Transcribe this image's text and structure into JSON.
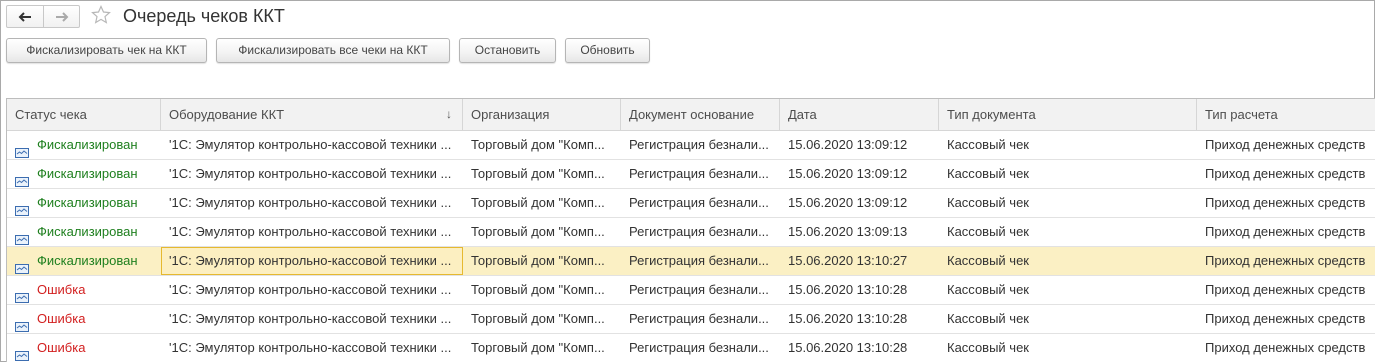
{
  "window": {
    "title": "Очередь чеков ККТ"
  },
  "toolbar": {
    "buttons": [
      "Фискализировать чек на ККТ",
      "Фискализировать все чеки на ККТ",
      "Остановить",
      "Обновить"
    ]
  },
  "table": {
    "sort_indicator": "↓",
    "columns": [
      "Статус чека",
      "Оборудование ККТ",
      "Организация",
      "Документ основание",
      "Дата",
      "Тип документа",
      "Тип расчета"
    ],
    "rows": [
      {
        "status": "Фискализирован",
        "status_kind": "ok",
        "equipment": "'1С: Эмулятор контрольно-кассовой техники ...",
        "organization": "Торговый дом \"Комп...",
        "document": "Регистрация безнали...",
        "date": "15.06.2020 13:09:12",
        "doc_type": "Кассовый чек",
        "payment_type": "Приход денежных средств"
      },
      {
        "status": "Фискализирован",
        "status_kind": "ok",
        "equipment": "'1С: Эмулятор контрольно-кассовой техники ...",
        "organization": "Торговый дом \"Комп...",
        "document": "Регистрация безнали...",
        "date": "15.06.2020 13:09:12",
        "doc_type": "Кассовый чек",
        "payment_type": "Приход денежных средств"
      },
      {
        "status": "Фискализирован",
        "status_kind": "ok",
        "equipment": "'1С: Эмулятор контрольно-кассовой техники ...",
        "organization": "Торговый дом \"Комп...",
        "document": "Регистрация безнали...",
        "date": "15.06.2020 13:09:12",
        "doc_type": "Кассовый чек",
        "payment_type": "Приход денежных средств"
      },
      {
        "status": "Фискализирован",
        "status_kind": "ok",
        "equipment": "'1С: Эмулятор контрольно-кассовой техники ...",
        "organization": "Торговый дом \"Комп...",
        "document": "Регистрация безнали...",
        "date": "15.06.2020 13:09:13",
        "doc_type": "Кассовый чек",
        "payment_type": "Приход денежных средств"
      },
      {
        "status": "Фискализирован",
        "status_kind": "ok",
        "selected": true,
        "equipment": "'1С: Эмулятор контрольно-кассовой техники ...",
        "organization": "Торговый дом \"Комп...",
        "document": "Регистрация безнали...",
        "date": "15.06.2020 13:10:27",
        "doc_type": "Кассовый чек",
        "payment_type": "Приход денежных средств"
      },
      {
        "status": "Ошибка",
        "status_kind": "error",
        "equipment": "'1С: Эмулятор контрольно-кассовой техники ...",
        "organization": "Торговый дом \"Комп...",
        "document": "Регистрация безнали...",
        "date": "15.06.2020 13:10:28",
        "doc_type": "Кассовый чек",
        "payment_type": "Приход денежных средств"
      },
      {
        "status": "Ошибка",
        "status_kind": "error",
        "equipment": "'1С: Эмулятор контрольно-кассовой техники ...",
        "organization": "Торговый дом \"Комп...",
        "document": "Регистрация безнали...",
        "date": "15.06.2020 13:10:28",
        "doc_type": "Кассовый чек",
        "payment_type": "Приход денежных средств"
      },
      {
        "status": "Ошибка",
        "status_kind": "error",
        "equipment": "'1С: Эмулятор контрольно-кассовой техники ...",
        "organization": "Торговый дом \"Комп...",
        "document": "Регистрация безнали...",
        "date": "15.06.2020 13:10:28",
        "doc_type": "Кассовый чек",
        "payment_type": "Приход денежных средств"
      }
    ]
  },
  "colors": {
    "ok": "#1e7f1e",
    "error": "#d21f1f",
    "selected_row": "#fbf0c4",
    "focus_border": "#e6b92f"
  },
  "icons": {
    "back": "arrow-left-icon",
    "forward": "arrow-right-icon",
    "favorite": "star-icon",
    "receipt": "receipt-icon"
  }
}
